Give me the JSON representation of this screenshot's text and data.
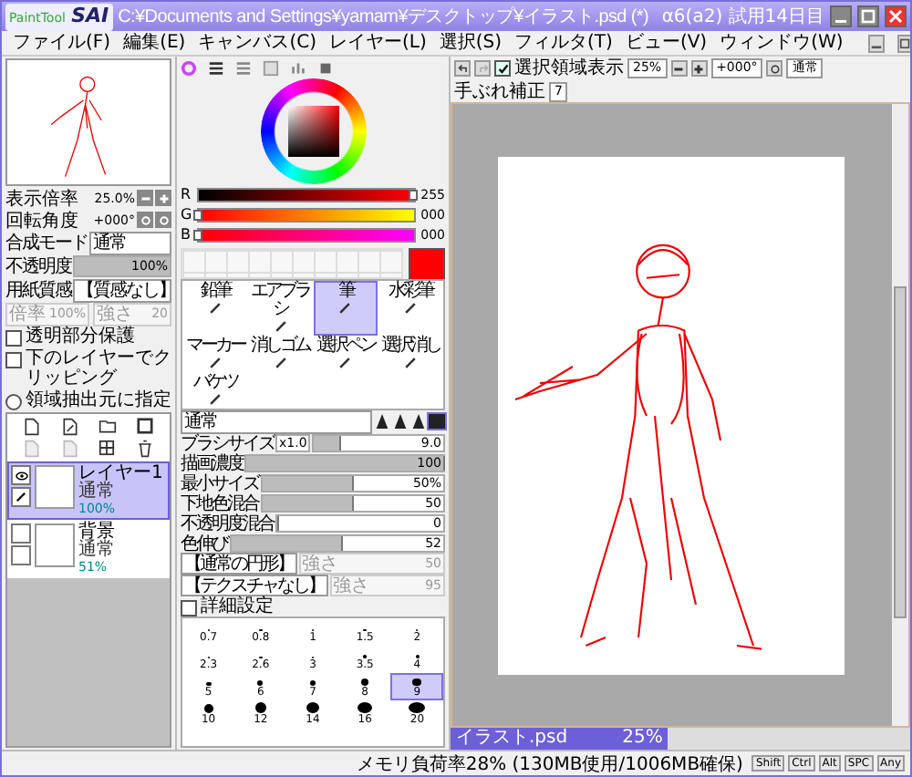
{
  "window": {
    "logo_small": "PaintTool",
    "logo_large": "SAI",
    "title": "C:¥Documents and Settings¥yamam¥デスクトップ¥イラスト.psd (*)",
    "trial": "α6(a2) 試用14日目"
  },
  "menu": [
    "ファイル(F)",
    "編集(E)",
    "キャンバス(C)",
    "レイヤー(L)",
    "選択(S)",
    "フィルタ(T)",
    "ビュー(V)",
    "ウィンドウ(W)"
  ],
  "navigator": {
    "zoom_label": "表示倍率",
    "zoom": "25.0%",
    "rotate_label": "回転角度",
    "rotate": "+000°"
  },
  "layer_props": {
    "blend_label": "合成モード",
    "blend": "通常",
    "opacity_label": "不透明度",
    "opacity": "100%",
    "level": 1,
    "paper_label": "用紙質感",
    "paper": "【質感なし】",
    "scale_label": "倍率",
    "scale": "100%",
    "strength_label": "強さ",
    "strength": "20"
  },
  "layer_options": [
    {
      "kind": "checkbox",
      "label": "透明部分保護",
      "checked": false
    },
    {
      "kind": "checkbox",
      "label": "下のレイヤーでクリッピング",
      "checked": false
    },
    {
      "kind": "radio",
      "label": "領域抽出元に指定",
      "checked": false
    }
  ],
  "layers": [
    {
      "name": "レイヤー1",
      "mode": "通常",
      "opacity": "100%",
      "selected": true,
      "visible": true
    },
    {
      "name": "背景",
      "mode": "通常",
      "opacity": "51%",
      "selected": false,
      "visible": false
    }
  ],
  "color": {
    "channels": [
      {
        "label": "R",
        "value": "255",
        "level": 1
      },
      {
        "label": "G",
        "value": "000",
        "level": 0
      },
      {
        "label": "B",
        "value": "000",
        "level": 0
      }
    ]
  },
  "tools": [
    {
      "label": "鉛筆",
      "selected": false
    },
    {
      "label": "エアブラシ",
      "selected": false
    },
    {
      "label": "筆",
      "selected": true
    },
    {
      "label": "水彩筆",
      "selected": false
    },
    {
      "label": "マーカー",
      "selected": false
    },
    {
      "label": "消しゴム",
      "selected": false
    },
    {
      "label": "選択ペン",
      "selected": false
    },
    {
      "label": "選択消し",
      "selected": false
    },
    {
      "label": "バケツ",
      "selected": false
    }
  ],
  "brush": {
    "mode": "通常",
    "shapes": [
      {
        "selected": false
      },
      {
        "selected": false
      },
      {
        "selected": false
      },
      {
        "selected": true
      }
    ],
    "params": [
      {
        "kind": "size",
        "label": "ブラシサイズ",
        "prefix": "x1.0",
        "value": "9.0",
        "level": 0.2
      },
      {
        "kind": "slider",
        "label": "描画濃度",
        "value": "100",
        "level": 1
      },
      {
        "kind": "slider",
        "label": "最小サイズ",
        "value": "50%",
        "level": 0.5
      },
      {
        "kind": "slider",
        "label": "下地色混合",
        "value": "50",
        "level": 0.5
      },
      {
        "kind": "slider",
        "label": "不透明度混合",
        "value": "0",
        "level": 0
      },
      {
        "kind": "slider",
        "label": "色伸び",
        "value": "52",
        "level": 0.52
      }
    ],
    "textures": [
      {
        "value": "【通常の円形】",
        "strength_label": "強さ",
        "strength": "50"
      },
      {
        "value": "【テクスチャなし】",
        "strength_label": "強さ",
        "strength": "95"
      }
    ],
    "detail": {
      "label": "詳細設定",
      "checked": false
    }
  },
  "brush_sizes": [
    {
      "label": "0.7",
      "selected": false
    },
    {
      "label": "0.8",
      "selected": false
    },
    {
      "label": "1",
      "selected": false
    },
    {
      "label": "1.5",
      "selected": false
    },
    {
      "label": "2",
      "selected": false
    },
    {
      "label": "2.3",
      "selected": false
    },
    {
      "label": "2.6",
      "selected": false
    },
    {
      "label": "3",
      "selected": false
    },
    {
      "label": "3.5",
      "selected": false
    },
    {
      "label": "4",
      "selected": false
    },
    {
      "label": "5",
      "selected": false
    },
    {
      "label": "6",
      "selected": false
    },
    {
      "label": "7",
      "selected": false
    },
    {
      "label": "8",
      "selected": false
    },
    {
      "label": "9",
      "selected": true
    },
    {
      "label": "10",
      "selected": false
    },
    {
      "label": "12",
      "selected": false
    },
    {
      "label": "14",
      "selected": false
    },
    {
      "label": "16",
      "selected": false
    },
    {
      "label": "20",
      "selected": false
    }
  ],
  "canvas_toolbar": {
    "show_selection": {
      "label": "選択領域表示",
      "checked": true
    },
    "zoom": "25%",
    "rotation": "+000°",
    "mode": "通常"
  },
  "stabilizer": {
    "label": "手ぶれ補正",
    "value": "7"
  },
  "document_tabs": [
    {
      "name": "イラスト.psd",
      "zoom": "25%",
      "selected": true
    }
  ],
  "status": {
    "memory": "メモリ負荷率28% (130MB使用/1006MB確保)",
    "keys": [
      "Shift",
      "Ctrl",
      "Alt",
      "SPC",
      "Any"
    ]
  }
}
